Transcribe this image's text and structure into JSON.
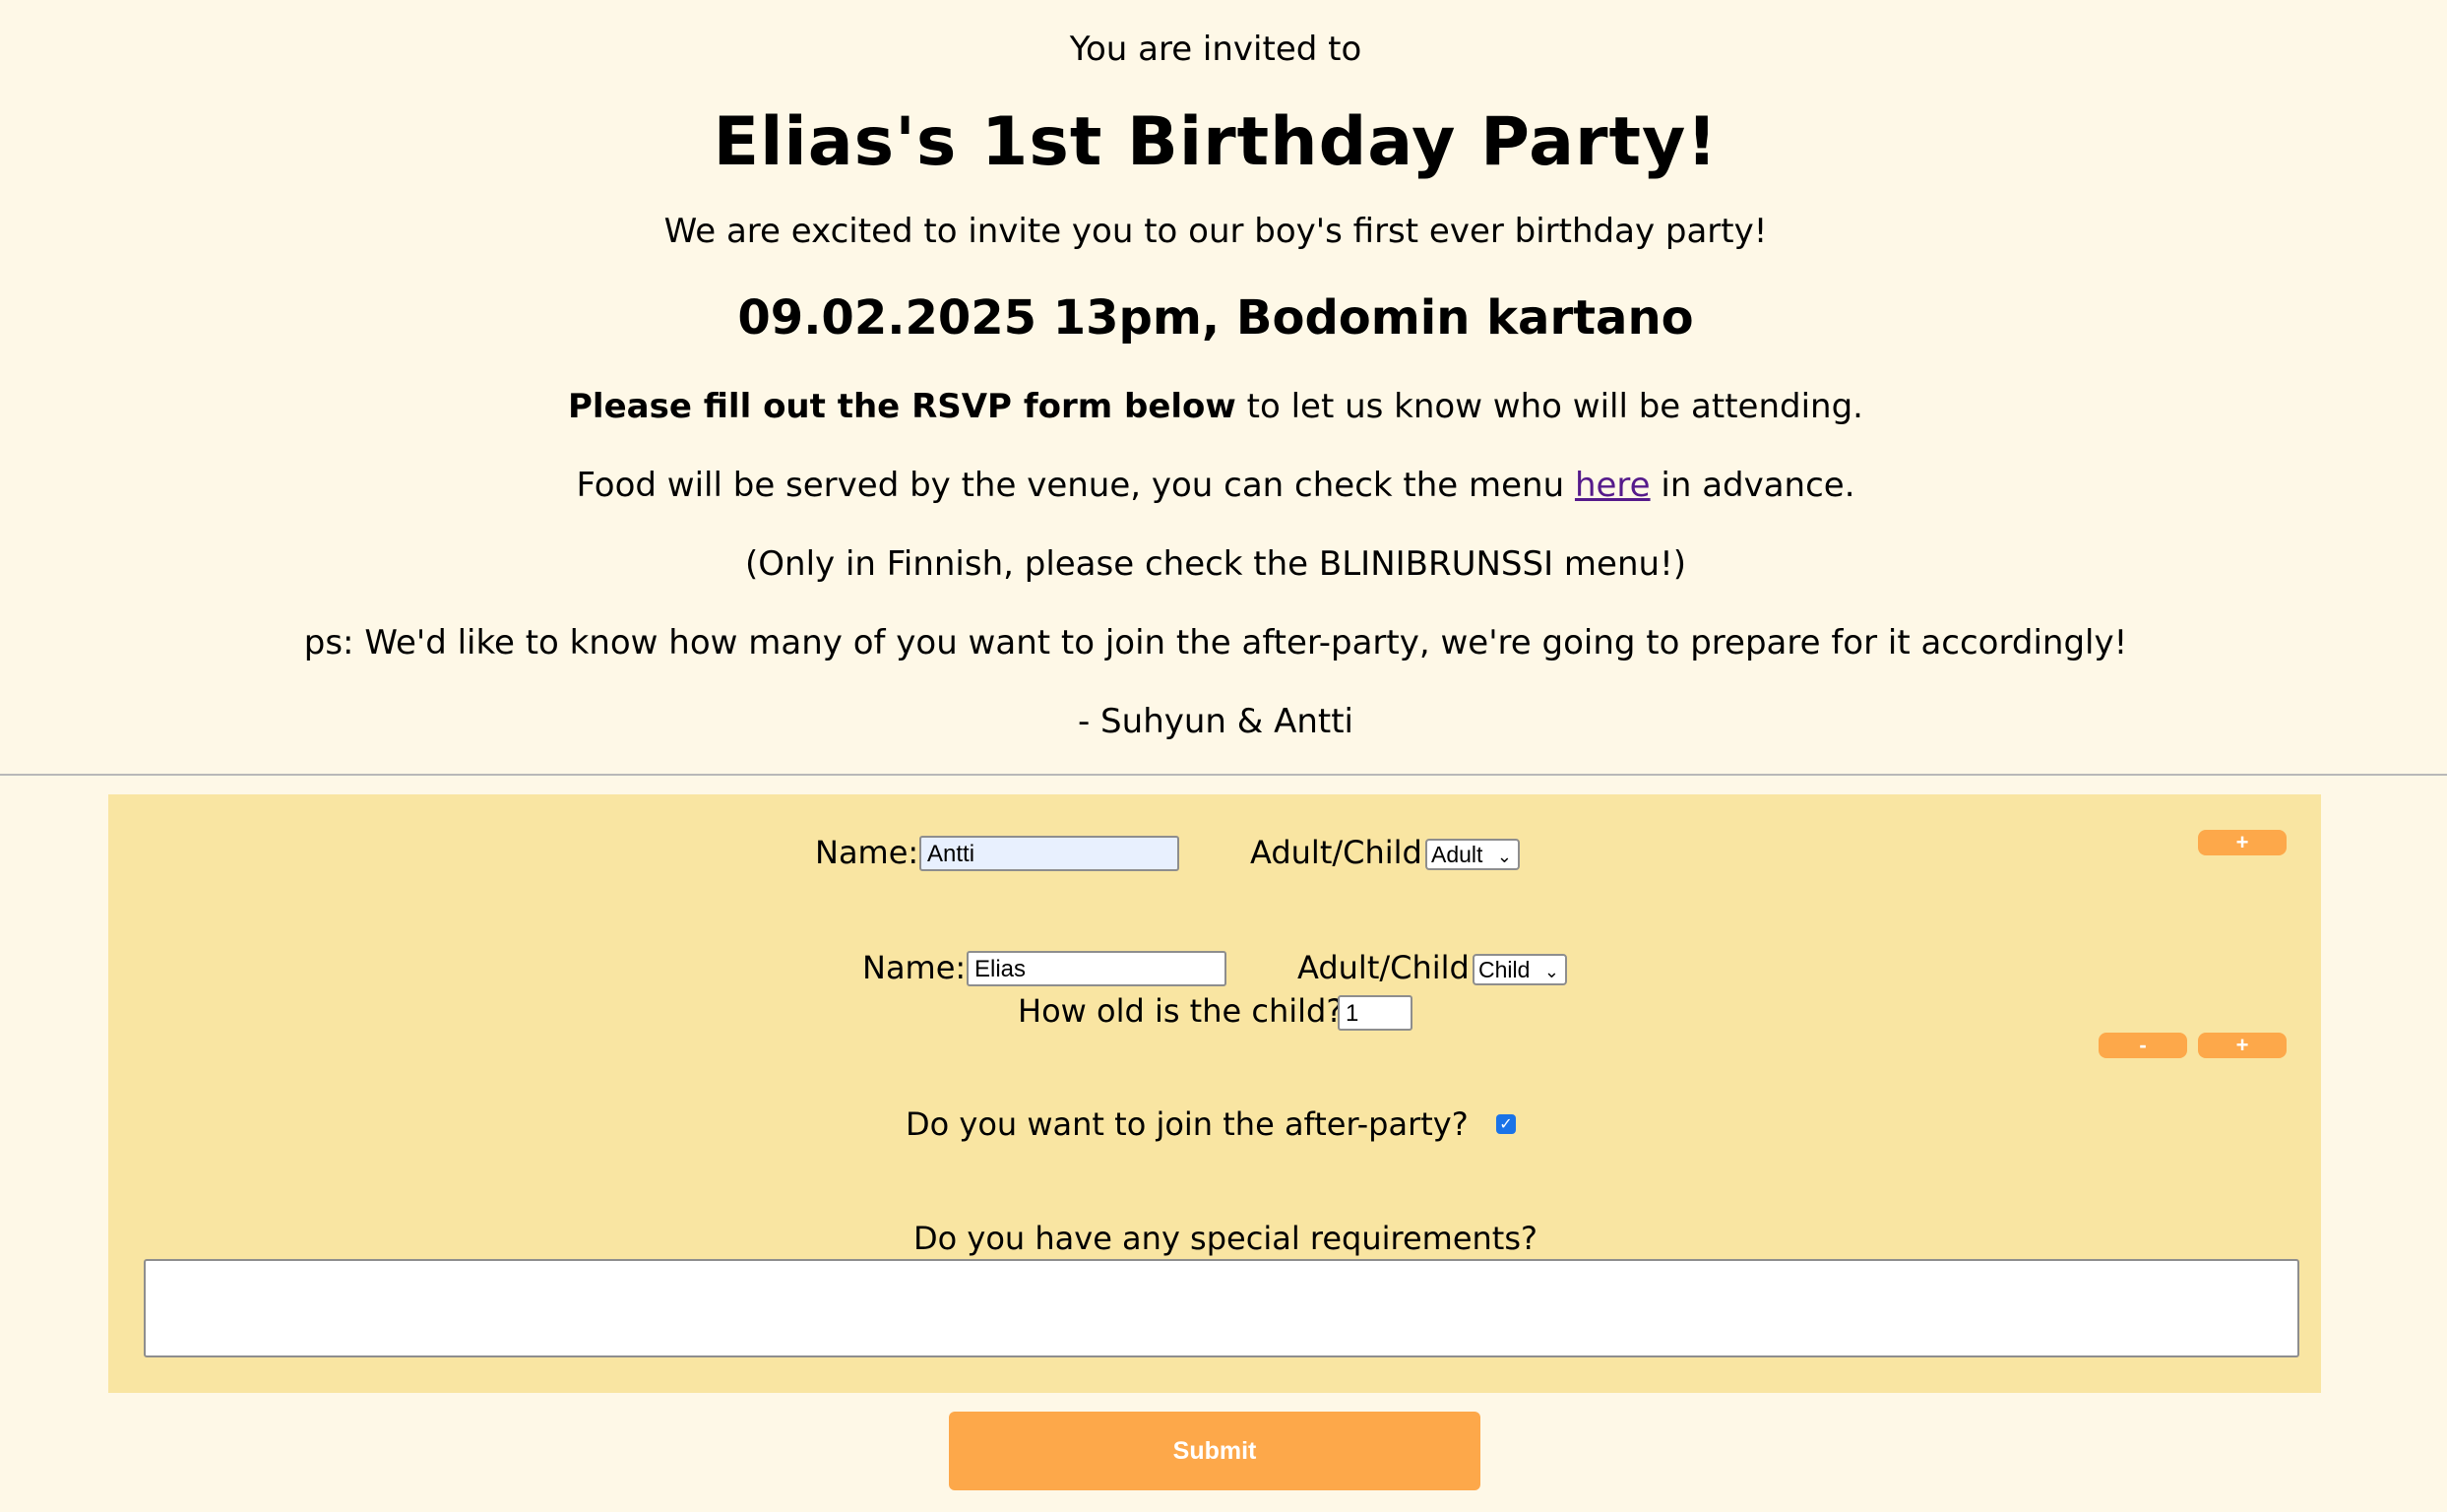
{
  "invitation": {
    "invited_text": "You are invited to",
    "title": "Elias's 1st Birthday Party!",
    "intro": "We are excited to invite you to our boy's first ever birthday party!",
    "date_location": "09.02.2025 13pm, Bodomin kartano",
    "rsvp_bold": "Please fill out the RSVP form below",
    "rsvp_rest": " to let us know who will be attending.",
    "menu_before": "Food will be served by the venue, you can check the menu ",
    "menu_link": "here",
    "menu_after": " in advance.",
    "finnish_note": "(Only in Finnish, please check the BLINIBRUNSSI menu!)",
    "ps": "ps: We'd like to know how many of you want to join the after-party, we're going to prepare for it accordingly!",
    "signature": "- Suhyun & Antti"
  },
  "form": {
    "guests": [
      {
        "name_label": "Name:",
        "name_value": "Antti",
        "type_label": "Adult/Child:",
        "type_value": "Adult"
      },
      {
        "name_label": "Name:",
        "name_value": "Elias",
        "type_label": "Adult/Child:",
        "type_value": "Child",
        "age_label": "How old is the child?",
        "age_value": "1"
      }
    ],
    "add_label": "+",
    "remove_label": "-",
    "after_party_label": "Do you want to join the after-party?",
    "after_party_checked": true,
    "requirements_label": "Do you have any special requirements?",
    "requirements_value": "",
    "submit_label": "Submit"
  },
  "colors": {
    "page_background": "#fef8e7",
    "form_background": "#f9e5a2",
    "button_accent": "#fda84a",
    "link": "#551a8b",
    "checkbox": "#1a73e8"
  }
}
